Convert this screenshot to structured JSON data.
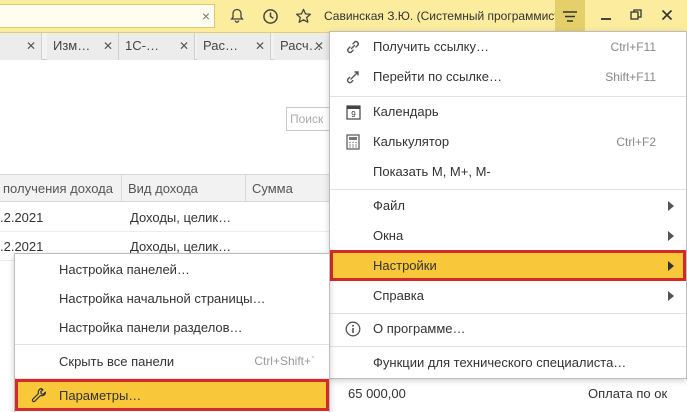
{
  "topbar": {
    "search_clear": "×",
    "user": "Савинская З.Ю. (Системный программист)",
    "icons": [
      "bell-icon",
      "history-icon",
      "star-icon",
      "menu-icon",
      "minimize-icon",
      "restore-icon",
      "close-icon"
    ]
  },
  "tabs": [
    {
      "label": "",
      "close": "✕"
    },
    {
      "label": "Изм…",
      "close": "✕"
    },
    {
      "label": "1С-…",
      "close": "✕"
    },
    {
      "label": "Рас…",
      "close": "✕"
    },
    {
      "label": "Расч…",
      "close": "✕"
    }
  ],
  "window": {
    "search_placeholder": "Поиск"
  },
  "grid": {
    "columns": [
      "получения дохода",
      "Вид дохода",
      "Сумма"
    ],
    "rows": [
      {
        "date": ".2.2021",
        "type": "Доходы, целик…"
      },
      {
        "date": ".2.2021",
        "type": "Доходы, целик…"
      }
    ]
  },
  "bottom_row": {
    "amount": "65 000,00",
    "note": "Оплата по ок"
  },
  "main_menu": {
    "items": [
      {
        "label": "Получить ссылку…",
        "shortcut": "Ctrl+F11",
        "icon": "link-icon"
      },
      {
        "label": "Перейти по ссылке…",
        "shortcut": "Shift+F11",
        "icon": "goto-link-icon"
      },
      {
        "label": "Календарь",
        "shortcut": "",
        "icon": "calendar-icon"
      },
      {
        "label": "Калькулятор",
        "shortcut": "Ctrl+F2",
        "icon": "calculator-icon"
      },
      {
        "label": "Показать М, М+, М-",
        "shortcut": "",
        "icon": ""
      },
      {
        "label": "Файл",
        "shortcut": "",
        "icon": ""
      },
      {
        "label": "Окна",
        "shortcut": "",
        "icon": ""
      },
      {
        "label": "Настройки",
        "shortcut": "",
        "icon": ""
      },
      {
        "label": "Справка",
        "shortcut": "",
        "icon": ""
      },
      {
        "label": "О программе…",
        "shortcut": "",
        "icon": "info-icon"
      },
      {
        "label": "Функции для технического специалиста…",
        "shortcut": "",
        "icon": ""
      }
    ],
    "calendar_day": "9"
  },
  "sub_menu": {
    "items": [
      {
        "label": "Настройка панелей…",
        "shortcut": ""
      },
      {
        "label": "Настройка начальной страницы…",
        "shortcut": ""
      },
      {
        "label": "Настройка панели разделов…",
        "shortcut": ""
      },
      {
        "label": "Скрыть все панели",
        "shortcut": "Ctrl+Shift+`"
      },
      {
        "label": "Параметры…",
        "shortcut": "",
        "icon": "wrench-icon"
      }
    ]
  },
  "colors": {
    "topbar_bg": "#fbec9e",
    "highlight_bg": "#f8c73a",
    "highlight_border": "#d42a2a"
  }
}
